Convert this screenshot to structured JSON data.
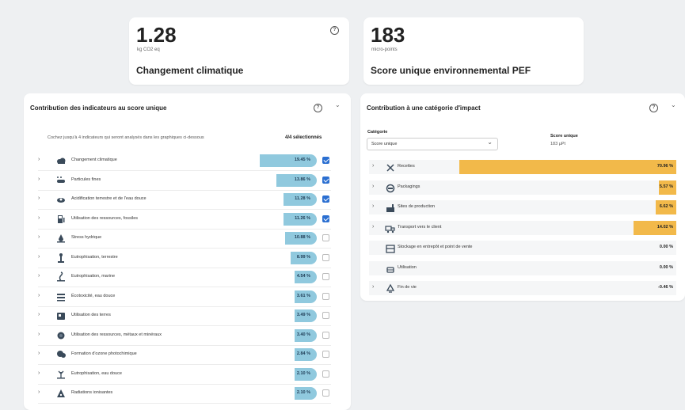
{
  "kpi_climate": {
    "value": "1.28",
    "unit": "kg CO2 eq",
    "label": "Changement climatique"
  },
  "kpi_pef": {
    "value": "183",
    "unit": "micro-points",
    "label": "Score unique environnemental PEF"
  },
  "left_panel": {
    "title": "Contribution des indicateurs au score unique",
    "instructions": "Cochez jusqu'à 4 indicateurs qui seront analysés dans les graphiques ci-dessous",
    "selected_count": "4/4 sélectionnés",
    "rows": [
      {
        "label": "Changement climatique",
        "value": "19.45 %",
        "pct": 19.45,
        "checked": true,
        "icon": "cloud-icon"
      },
      {
        "label": "Particules fines",
        "value": "13.86 %",
        "pct": 13.86,
        "checked": true,
        "icon": "fine-particles-icon"
      },
      {
        "label": "Acidification terrestre et de l'eau douce",
        "value": "11.28 %",
        "pct": 11.28,
        "checked": true,
        "icon": "acidification-icon"
      },
      {
        "label": "Utilisation des ressources, fossiles",
        "value": "11.26 %",
        "pct": 11.26,
        "checked": true,
        "icon": "fuel-pump-icon"
      },
      {
        "label": "Stress hydrique",
        "value": "10.88 %",
        "pct": 10.88,
        "checked": false,
        "icon": "water-drop-icon"
      },
      {
        "label": "Eutrophisation, terrestre",
        "value": "8.99 %",
        "pct": 8.99,
        "checked": false,
        "icon": "plant-icon"
      },
      {
        "label": "Eutrophisation, marine",
        "value": "4.54 %",
        "pct": 4.54,
        "checked": false,
        "icon": "seaweed-icon"
      },
      {
        "label": "Écotoxicité, eau douce",
        "value": "3.61 %",
        "pct": 3.61,
        "checked": false,
        "icon": "fish-icon"
      },
      {
        "label": "Utilisation des terres",
        "value": "3.49 %",
        "pct": 3.49,
        "checked": false,
        "icon": "land-icon"
      },
      {
        "label": "Utilisation des ressources, métaux et minéraux",
        "value": "3.40 %",
        "pct": 3.4,
        "checked": false,
        "icon": "minerals-icon"
      },
      {
        "label": "Formation d'ozone photochimique",
        "value": "2.84 %",
        "pct": 2.84,
        "checked": false,
        "icon": "smog-icon"
      },
      {
        "label": "Eutrophisation, eau douce",
        "value": "2.10 %",
        "pct": 2.1,
        "checked": false,
        "icon": "freshwater-plant-icon"
      },
      {
        "label": "Radiations ionisantes",
        "value": "2.10 %",
        "pct": 2.1,
        "checked": false,
        "icon": "radiation-icon"
      }
    ]
  },
  "right_panel": {
    "title": "Contribution à une catégorie d'impact",
    "category_label": "Catégorie",
    "category_selected": "Score unique",
    "score_label": "Score unique",
    "score_value": "183 µPt",
    "rows": [
      {
        "label": "Recettes",
        "value": "70.96 %",
        "pct": 70.96,
        "expandable": true,
        "icon": "utensils-icon"
      },
      {
        "label": "Packagings",
        "value": "5.57 %",
        "pct": 5.57,
        "expandable": true,
        "icon": "package-icon"
      },
      {
        "label": "Sites de production",
        "value": "6.62 %",
        "pct": 6.62,
        "expandable": true,
        "icon": "factory-icon"
      },
      {
        "label": "Transport vers le client",
        "value": "14.02 %",
        "pct": 14.02,
        "expandable": true,
        "icon": "truck-icon"
      },
      {
        "label": "Stockage en entrepôt et point de vente",
        "value": "0.00 %",
        "pct": 0,
        "expandable": false,
        "icon": "warehouse-icon"
      },
      {
        "label": "Utilisation",
        "value": "0.00 %",
        "pct": 0,
        "expandable": false,
        "icon": "cooking-icon"
      },
      {
        "label": "Fin de vie",
        "value": "-0.46 %",
        "pct": 0,
        "expandable": true,
        "icon": "recycle-icon"
      }
    ]
  },
  "icons": {
    "help": "?",
    "chevron": "⌄",
    "expand": "›"
  },
  "colors": {
    "blue_bar": "#90c9de",
    "orange_bar": "#f2b94a",
    "checkbox": "#2b6fd1"
  }
}
